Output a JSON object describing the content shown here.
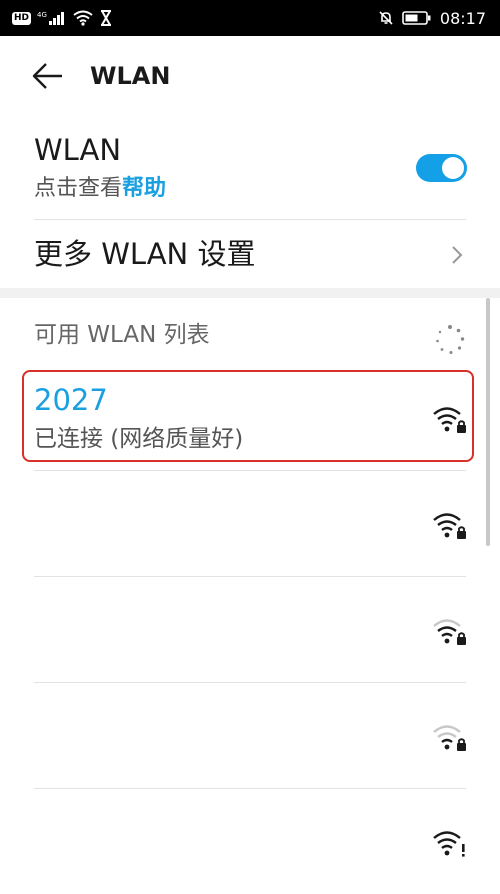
{
  "status_bar": {
    "badge_hd": "HD",
    "badge_4g": "4G",
    "time": "08:17",
    "icons": [
      "hd-icon",
      "cellular-signal-icon",
      "wifi-icon",
      "hourglass-icon",
      "mute-bell-icon",
      "battery-icon"
    ]
  },
  "appbar": {
    "title": "WLAN",
    "back_icon": "back-arrow-icon"
  },
  "wlan_toggle": {
    "title": "WLAN",
    "subtitle_prefix": "点击查看",
    "subtitle_link": "帮助",
    "enabled": true,
    "accent_color": "#13a0e6"
  },
  "more_settings": {
    "label": "更多 WLAN 设置",
    "chevron_icon": "chevron-right-icon"
  },
  "list": {
    "header": "可用 WLAN 列表",
    "scanning_icon": "spinner-icon",
    "connected": {
      "name": "2027",
      "status": "已连接 (网络质量好)",
      "highlight_color": "#d9302a",
      "signal_icon": "wifi-lock-icon"
    },
    "networks": [
      {
        "name": "",
        "signal_icon": "wifi-lock-icon"
      },
      {
        "name": "",
        "signal_icon": "wifi-lock-icon"
      },
      {
        "name": "",
        "signal_icon": "wifi-lock-icon"
      },
      {
        "name": "",
        "signal_icon": "wifi-alert-icon"
      }
    ]
  }
}
